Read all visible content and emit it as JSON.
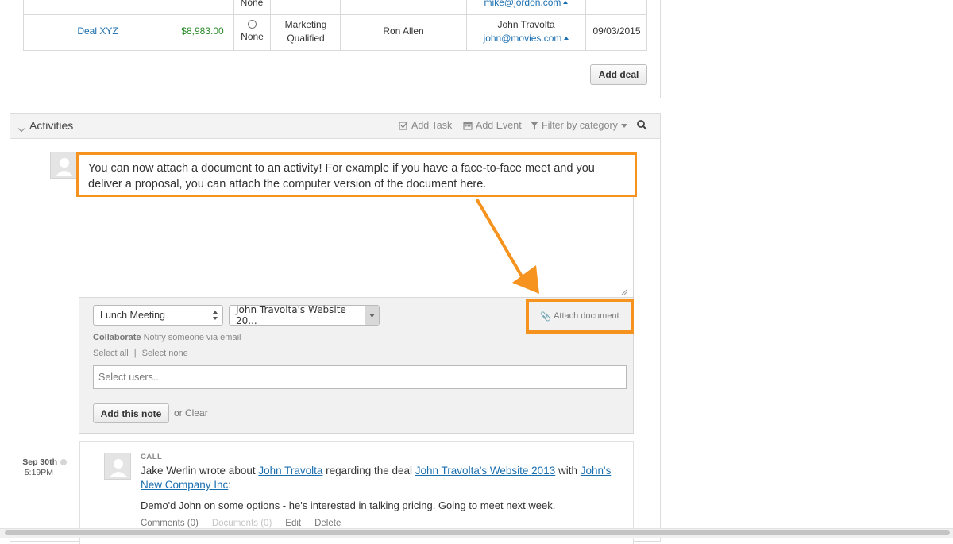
{
  "deals": {
    "top_row": {
      "cells": {
        "probability": "None",
        "contact_email": "mike@jordon.com"
      }
    },
    "row": {
      "name": "Deal XYZ",
      "value": "$8,983.00",
      "probability": "None",
      "stage_line1": "Marketing",
      "stage_line2": "Qualified",
      "owner": "Ron Allen",
      "contact_name": "John Travolta",
      "contact_email": "john@movies.com",
      "date": "09/03/2015"
    },
    "add_deal_label": "Add deal",
    "colors": {
      "link": "#1a6fb0",
      "value": "#2a8a2a"
    }
  },
  "activities": {
    "title": "Activities",
    "toolbar": {
      "add_task": "Add Task",
      "add_event": "Add Event",
      "filter": "Filter by category"
    },
    "callout_text": "You can now attach a document to an activity! For example if you have a face-to-face meet and you deliver a proposal, you can attach the computer version of the document here.",
    "callout_color": "#f5931e",
    "note_form": {
      "category_value": "Lunch Meeting",
      "deal_value": "John Travolta's Website 20...",
      "attach_label": "Attach document",
      "collaborate_label": "Collaborate",
      "collaborate_hint": "Notify someone via email",
      "select_all": "Select all",
      "separator": "|",
      "select_none": "Select none",
      "users_placeholder": "Select users...",
      "add_note_label": "Add this note",
      "or_text": "or",
      "clear_label": "Clear"
    },
    "entry": {
      "date": "Sep 30th",
      "time": "5:19PM",
      "type": "CALL",
      "author": "Jake Werlin",
      "wrote_about": "wrote about",
      "contact": "John Travolta",
      "regarding": "regarding the deal",
      "deal": "John Travolta's Website 2013",
      "with": "with",
      "company": "John's New Company Inc",
      "colon": ":",
      "body": "Demo'd John on some options - he's interested in talking pricing. Going to meet next week.",
      "comments": "Comments (0)",
      "documents": "Documents (0)",
      "edit": "Edit",
      "delete": "Delete"
    }
  }
}
